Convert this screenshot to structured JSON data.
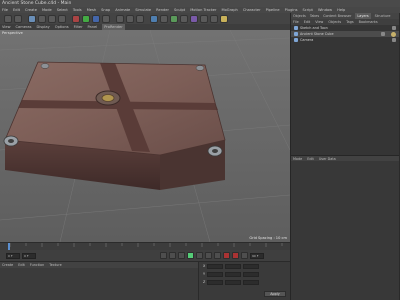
{
  "window": {
    "title": "Ancient Stone Cube.c4d - Main"
  },
  "menubar": {
    "items": [
      "File",
      "Edit",
      "Create",
      "Mode",
      "Select",
      "Tools",
      "Mesh",
      "Snap",
      "Animate",
      "Simulate",
      "Render",
      "Sculpt",
      "Motion Tracker",
      "MoGraph",
      "Character",
      "Pipeline",
      "Plugins",
      "Script",
      "Window",
      "Help"
    ]
  },
  "viewport": {
    "menu": [
      "View",
      "Cameras",
      "Display",
      "Options",
      "Filter",
      "Panel",
      "ProRender"
    ],
    "active_menu": "ProRender",
    "label": "Perspective",
    "grid_info": "Grid Spacing : 10 cm"
  },
  "timeline": {
    "start_frame": "0 F",
    "end_frame": "90 F",
    "current": "0 F"
  },
  "materials": {
    "menu": [
      "Create",
      "Edit",
      "Function",
      "Texture"
    ]
  },
  "coords": {
    "apply_label": "Apply",
    "rows": [
      "X",
      "Y",
      "Z"
    ]
  },
  "object_manager": {
    "tabs": [
      "Objects",
      "Takes",
      "Content Browser",
      "Layers",
      "Structure"
    ],
    "selected_tab": "Layers",
    "menu": [
      "File",
      "Edit",
      "View",
      "Objects",
      "Tags",
      "Bookmarks"
    ],
    "objects": [
      {
        "name": "Sketch and Toon"
      },
      {
        "name": "Ancient Stone Cube"
      },
      {
        "name": "Camera"
      }
    ]
  },
  "attributes": {
    "menu": [
      "Mode",
      "Edit",
      "User Data"
    ]
  }
}
